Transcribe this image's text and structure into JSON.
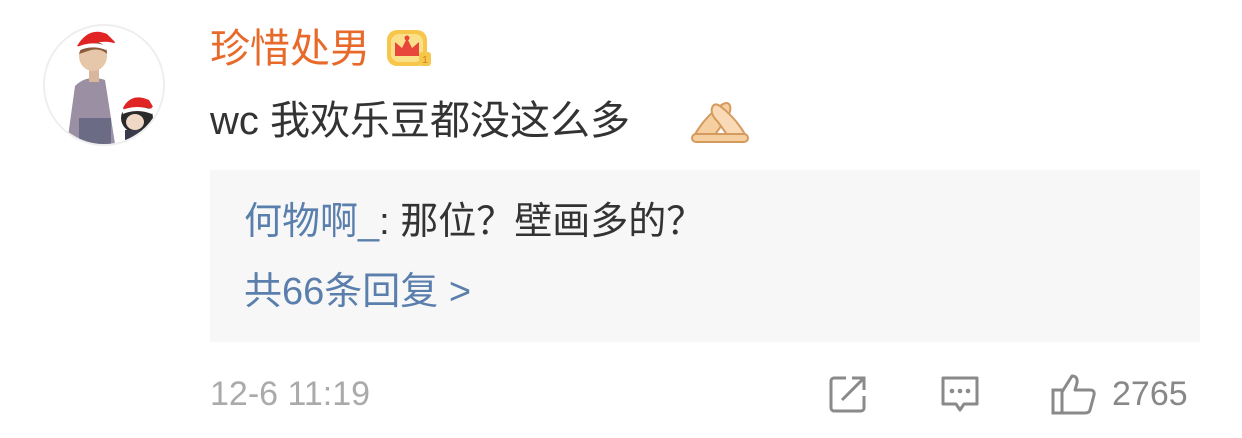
{
  "comment": {
    "username": "珍惜处男",
    "text": "wc 我欢乐豆都没这么多",
    "vip_badge_icon": "crown-badge-icon",
    "emoji_icon": "pray-hands-emoji-icon",
    "avatar_icon": "christmas-hat-avatar-icon"
  },
  "reply_preview": {
    "user": "何物啊_",
    "separator": ": ",
    "text": "那位？壁画多的？",
    "count_label": "共66条回复 >"
  },
  "footer": {
    "timestamp": "12-6 11:19",
    "like_count": "2765",
    "share_icon": "share-icon",
    "reply_icon": "comment-icon",
    "like_icon": "thumbs-up-icon"
  },
  "colors": {
    "username": "#e86a2b",
    "link": "#5b7fac",
    "reply_bg": "#f7f7f7"
  }
}
